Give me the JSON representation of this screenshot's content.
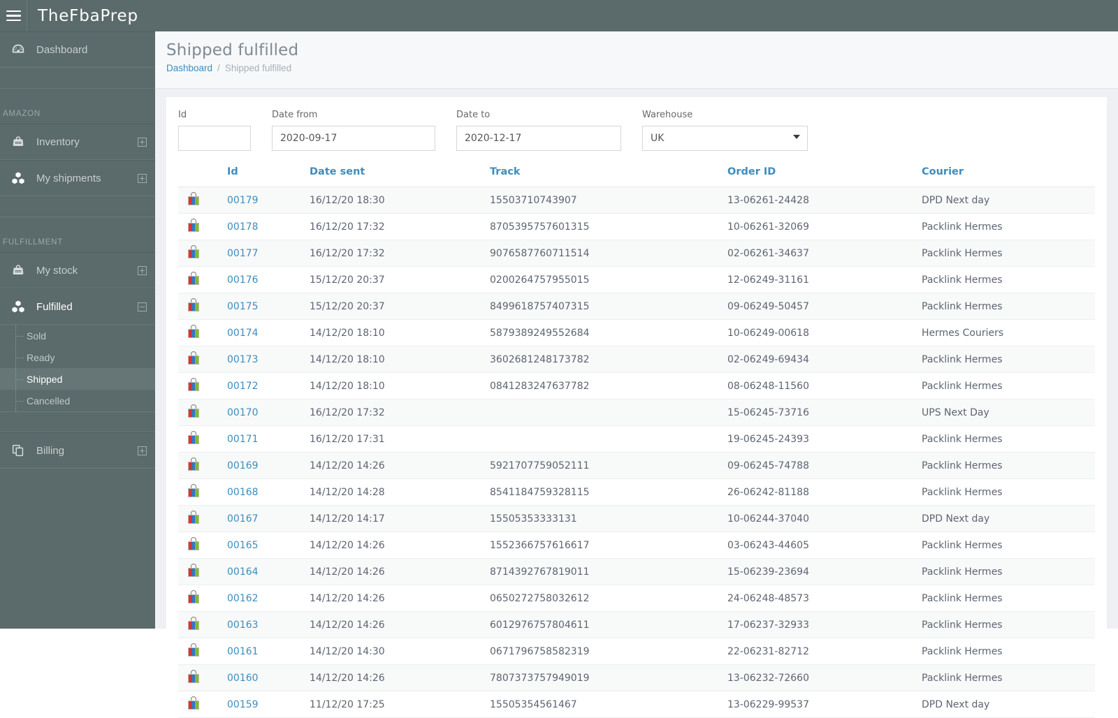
{
  "app": {
    "brand": "TheFbaPrep",
    "menu_icon": "hamburger-icon"
  },
  "sidebar": {
    "dashboard": {
      "label": "Dashboard",
      "icon": "speedometer-icon"
    },
    "sections": [
      {
        "title": "AMAZON",
        "items": [
          {
            "label": "Inventory",
            "icon": "handbag-icon",
            "expander": "plus"
          },
          {
            "label": "My shipments",
            "icon": "boxes-icon",
            "expander": "plus"
          }
        ]
      },
      {
        "title": "FULFILLMENT",
        "items": [
          {
            "label": "My stock",
            "icon": "handbag-icon",
            "expander": "plus"
          },
          {
            "label": "Fulfilled",
            "icon": "boxes-icon",
            "expander": "minus"
          }
        ]
      }
    ],
    "fulfilled_children": [
      {
        "label": "Sold",
        "active": false
      },
      {
        "label": "Ready",
        "active": false
      },
      {
        "label": "Shipped",
        "active": true
      },
      {
        "label": "Cancelled",
        "active": false
      }
    ],
    "billing": {
      "label": "Billing",
      "icon": "copy-icon",
      "expander": "plus"
    }
  },
  "header": {
    "title": "Shipped fulfilled",
    "breadcrumb": {
      "root": "Dashboard",
      "separator": "/",
      "current": "Shipped fulfilled"
    }
  },
  "filters": {
    "id": {
      "label": "Id",
      "value": "",
      "placeholder": ""
    },
    "date_from": {
      "label": "Date from",
      "value": "2020-09-17"
    },
    "date_to": {
      "label": "Date to",
      "value": "2020-12-17"
    },
    "warehouse": {
      "label": "Warehouse",
      "value": "UK",
      "options": [
        "UK"
      ]
    }
  },
  "table": {
    "columns": [
      "",
      "Id",
      "Date sent",
      "Track",
      "Order ID",
      "Courier"
    ],
    "rows": [
      {
        "icon": "shopping-bag-icon",
        "id": "00179",
        "date_sent": "16/12/20 18:30",
        "track": "15503710743907",
        "order_id": "13-06261-24428",
        "courier": "DPD Next day"
      },
      {
        "icon": "shopping-bag-icon",
        "id": "00178",
        "date_sent": "16/12/20 17:32",
        "track": "8705395757601315",
        "order_id": "10-06261-32069",
        "courier": "Packlink Hermes"
      },
      {
        "icon": "shopping-bag-icon",
        "id": "00177",
        "date_sent": "16/12/20 17:32",
        "track": "9076587760711514",
        "order_id": "02-06261-34637",
        "courier": "Packlink Hermes"
      },
      {
        "icon": "shopping-bag-icon",
        "id": "00176",
        "date_sent": "15/12/20 20:37",
        "track": "0200264757955015",
        "order_id": "12-06249-31161",
        "courier": "Packlink Hermes"
      },
      {
        "icon": "shopping-bag-icon",
        "id": "00175",
        "date_sent": "15/12/20 20:37",
        "track": "8499618757407315",
        "order_id": "09-06249-50457",
        "courier": "Packlink Hermes"
      },
      {
        "icon": "shopping-bag-icon",
        "id": "00174",
        "date_sent": "14/12/20 18:10",
        "track": "5879389249552684",
        "order_id": "10-06249-00618",
        "courier": "Hermes Couriers"
      },
      {
        "icon": "shopping-bag-icon",
        "id": "00173",
        "date_sent": "14/12/20 18:10",
        "track": "3602681248173782",
        "order_id": "02-06249-69434",
        "courier": "Packlink Hermes"
      },
      {
        "icon": "shopping-bag-icon",
        "id": "00172",
        "date_sent": "14/12/20 18:10",
        "track": "0841283247637782",
        "order_id": "08-06248-11560",
        "courier": "Packlink Hermes"
      },
      {
        "icon": "shopping-bag-icon",
        "id": "00170",
        "date_sent": "16/12/20 17:32",
        "track": "",
        "order_id": "15-06245-73716",
        "courier": "UPS Next Day"
      },
      {
        "icon": "shopping-bag-icon",
        "id": "00171",
        "date_sent": "16/12/20 17:31",
        "track": "",
        "order_id": "19-06245-24393",
        "courier": "Packlink Hermes"
      },
      {
        "icon": "shopping-bag-icon",
        "id": "00169",
        "date_sent": "14/12/20 14:26",
        "track": "5921707759052111",
        "order_id": "09-06245-74788",
        "courier": "Packlink Hermes"
      },
      {
        "icon": "shopping-bag-icon",
        "id": "00168",
        "date_sent": "14/12/20 14:28",
        "track": "8541184759328115",
        "order_id": "26-06242-81188",
        "courier": "Packlink Hermes"
      },
      {
        "icon": "shopping-bag-icon",
        "id": "00167",
        "date_sent": "14/12/20 14:17",
        "track": "15505353333131",
        "order_id": "10-06244-37040",
        "courier": "DPD Next day"
      },
      {
        "icon": "shopping-bag-icon",
        "id": "00165",
        "date_sent": "14/12/20 14:26",
        "track": "1552366757616617",
        "order_id": "03-06243-44605",
        "courier": "Packlink Hermes"
      },
      {
        "icon": "shopping-bag-icon",
        "id": "00164",
        "date_sent": "14/12/20 14:26",
        "track": "8714392767819011",
        "order_id": "15-06239-23694",
        "courier": "Packlink Hermes"
      },
      {
        "icon": "shopping-bag-icon",
        "id": "00162",
        "date_sent": "14/12/20 14:26",
        "track": "0650272758032612",
        "order_id": "24-06248-48573",
        "courier": "Packlink Hermes"
      },
      {
        "icon": "shopping-bag-icon",
        "id": "00163",
        "date_sent": "14/12/20 14:26",
        "track": "6012976757804611",
        "order_id": "17-06237-32933",
        "courier": "Packlink Hermes"
      },
      {
        "icon": "shopping-bag-icon",
        "id": "00161",
        "date_sent": "14/12/20 14:30",
        "track": "0671796758582319",
        "order_id": "22-06231-82712",
        "courier": "Packlink Hermes"
      },
      {
        "icon": "shopping-bag-icon",
        "id": "00160",
        "date_sent": "14/12/20 14:26",
        "track": "7807373757949019",
        "order_id": "13-06232-72660",
        "courier": "Packlink Hermes"
      },
      {
        "icon": "shopping-bag-icon",
        "id": "00159",
        "date_sent": "11/12/20 17:25",
        "track": "15505354561467",
        "order_id": "13-06229-99537",
        "courier": "DPD Next day"
      }
    ]
  },
  "colors": {
    "sidebar_bg": "#5b6a6a",
    "link": "#3c8dbc",
    "content_bg": "#eef0f4",
    "title": "#7e8a96"
  }
}
